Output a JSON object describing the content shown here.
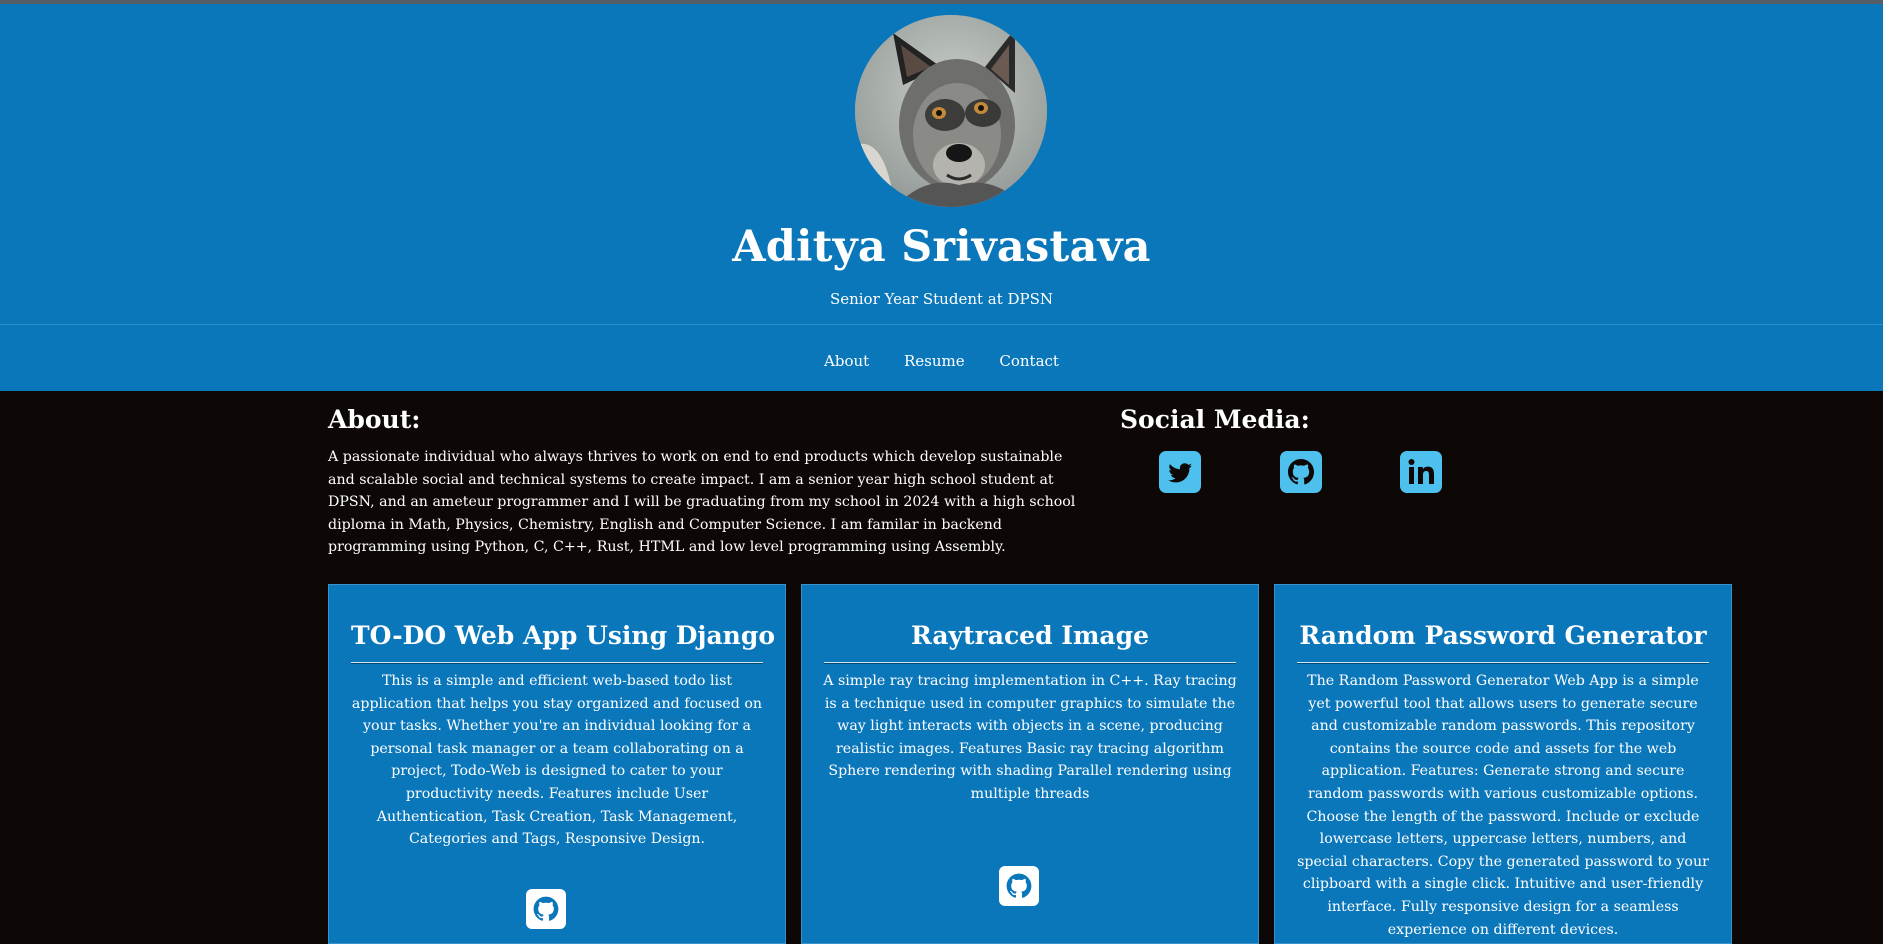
{
  "header": {
    "name": "Aditya Srivastava",
    "subtitle": "Senior Year Student at DPSN",
    "nav": [
      "About",
      "Resume",
      "Contact"
    ]
  },
  "about": {
    "title": "About:",
    "text": "A passionate individual who always thrives to work on end to end products which develop sustainable and scalable social and technical systems to create impact. I am a senior year high school student at DPSN, and an ameteur programmer and I will be graduating from my school in 2024 with a high school diploma in Math, Physics, Chemistry, English and Computer Science. I am familar in backend programming using Python, C, C++, Rust, HTML and low level programming using Assembly."
  },
  "social": {
    "title": "Social Media:",
    "icons": [
      "twitter-icon",
      "github-icon",
      "linkedin-icon"
    ]
  },
  "projects": [
    {
      "title": "TO-DO Web App Using Django",
      "description": "This is a simple and efficient web-based todo list application that helps you stay organized and focused on your tasks. Whether you're an individual looking for a personal task manager or a team collaborating on a project, Todo-Web is designed to cater to your productivity needs. Features include User Authentication, Task Creation, Task Management, Categories and Tags, Responsive Design."
    },
    {
      "title": "Raytraced Image",
      "description": "A simple ray tracing implementation in C++. Ray tracing is a technique used in computer graphics to simulate the way light interacts with objects in a scene, producing realistic images. Features Basic ray tracing algorithm Sphere rendering with shading Parallel rendering using multiple threads"
    },
    {
      "title": "Random Password Generator",
      "description": "The Random Password Generator Web App is a simple yet powerful tool that allows users to generate secure and customizable random passwords. This repository contains the source code and assets for the web application. Features: Generate strong and secure random passwords with various customizable options. Choose the length of the password. Include or exclude lowercase letters, uppercase letters, numbers, and special characters. Copy the generated password to your clipboard with a single click. Intuitive and user-friendly interface. Fully responsive design for a seamless experience on different devices."
    }
  ],
  "colors": {
    "header_bg": "#0a77bb",
    "page_bg": "#0d0705",
    "social_icon": "#4ec0ee"
  }
}
